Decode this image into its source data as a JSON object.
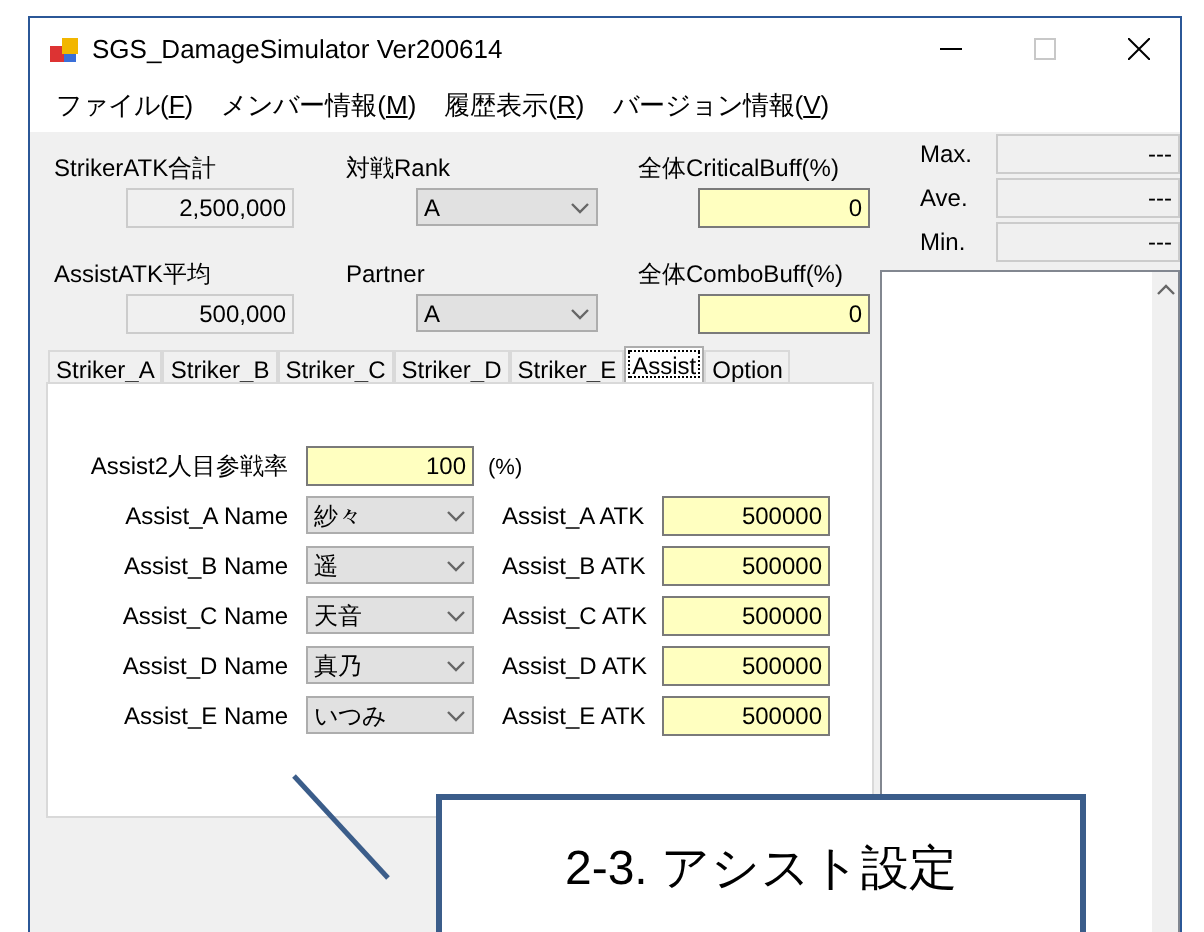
{
  "window": {
    "title": "SGS_DamageSimulator Ver200614"
  },
  "menu": [
    {
      "before": "ファイル(",
      "key": "F",
      "after": ")"
    },
    {
      "before": "メンバー情報(",
      "key": "M",
      "after": ")"
    },
    {
      "before": "履歴表示(",
      "key": "R",
      "after": ")"
    },
    {
      "before": "バージョン情報(",
      "key": "V",
      "after": ")"
    }
  ],
  "settings": [
    {
      "kind": "readonly",
      "label": "StrikerATK合計",
      "value": "2,500,000"
    },
    {
      "kind": "select",
      "label": "対戦Rank",
      "value": "A"
    },
    {
      "kind": "input",
      "label": "全体CriticalBuff(%)",
      "value": "0"
    },
    {
      "kind": "readonly",
      "label": "AssistATK平均",
      "value": "500,000"
    },
    {
      "kind": "select",
      "label": "Partner",
      "value": "A"
    },
    {
      "kind": "input",
      "label": "全体ComboBuff(%)",
      "value": "0"
    }
  ],
  "stats": [
    {
      "label": "Max.",
      "value": "---"
    },
    {
      "label": "Ave.",
      "value": "---"
    },
    {
      "label": "Min.",
      "value": "---"
    }
  ],
  "tabs": [
    {
      "label": "Striker_A",
      "selected": false
    },
    {
      "label": "Striker_B",
      "selected": false
    },
    {
      "label": "Striker_C",
      "selected": false
    },
    {
      "label": "Striker_D",
      "selected": false
    },
    {
      "label": "Striker_E",
      "selected": false
    },
    {
      "label": "Assist",
      "selected": true
    },
    {
      "label": "Option",
      "selected": false
    }
  ],
  "assist_panel": {
    "rate": {
      "label": "Assist2人目参戦率",
      "value": "100",
      "unit": "(%)"
    },
    "rows": [
      {
        "name_label": "Assist_A Name",
        "name": "紗々",
        "atk_label": "Assist_A ATK",
        "atk": "500000"
      },
      {
        "name_label": "Assist_B Name",
        "name": "遥",
        "atk_label": "Assist_B ATK",
        "atk": "500000"
      },
      {
        "name_label": "Assist_C Name",
        "name": "天音",
        "atk_label": "Assist_C ATK",
        "atk": "500000"
      },
      {
        "name_label": "Assist_D Name",
        "name": "真乃",
        "atk_label": "Assist_D ATK",
        "atk": "500000"
      },
      {
        "name_label": "Assist_E Name",
        "name": "いつみ",
        "atk_label": "Assist_E ATK",
        "atk": "500000"
      }
    ]
  },
  "callout": {
    "text": "2-3. アシスト設定"
  }
}
